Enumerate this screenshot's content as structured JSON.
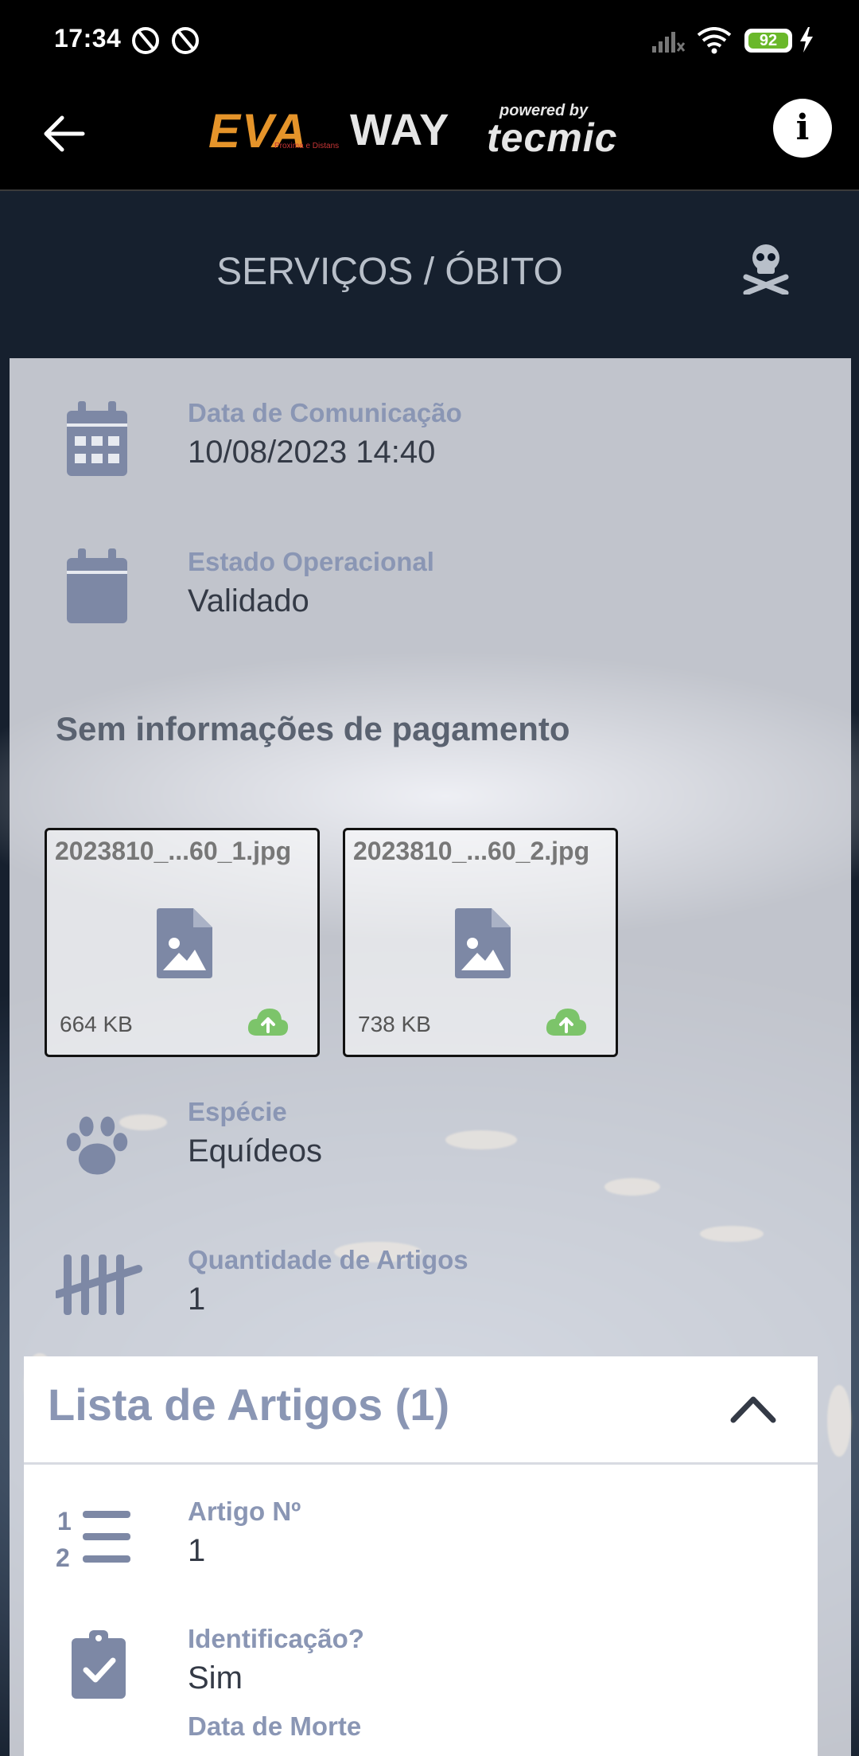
{
  "status_bar": {
    "time": "17:34",
    "battery_level": "92"
  },
  "app_bar": {
    "logo_eva": "EVA",
    "logo_eva_sub": "Proxima e Distans",
    "logo_way": "WAY",
    "powered_by": "powered by",
    "logo_tecmic": "tecmic",
    "info_label": "i"
  },
  "header": {
    "title": "SERVIÇOS / ÓBITO",
    "icon": "skull-crossbones-icon"
  },
  "details": [
    {
      "label": "Data de Comunicação",
      "value": "10/08/2023 14:40",
      "icon": "calendar-grid-icon"
    },
    {
      "label": "Estado Operacional",
      "value": "Validado",
      "icon": "calendar-icon"
    }
  ],
  "payment_message": "Sem informações de pagamento",
  "attachments": [
    {
      "name": "2023810_...60_1.jpg",
      "size": "664 KB",
      "icon": "image-file-icon",
      "status_icon": "cloud-upload-icon"
    },
    {
      "name": "2023810_...60_2.jpg",
      "size": "738 KB",
      "icon": "image-file-icon",
      "status_icon": "cloud-upload-icon"
    }
  ],
  "details_2": [
    {
      "label": "Espécie",
      "value": "Equídeos",
      "icon": "paw-icon"
    },
    {
      "label": "Quantidade de Artigos",
      "value": "1",
      "icon": "tally-icon"
    }
  ],
  "articles_list": {
    "title": "Lista de Artigos (1)",
    "items": [
      {
        "label": "Artigo Nº",
        "value": "1",
        "icon": "numbered-list-icon"
      },
      {
        "label": "Identificação?",
        "value": "Sim",
        "icon": "clipboard-check-icon"
      }
    ],
    "next_label": "Data de Morte"
  },
  "colors": {
    "label": "#8a96b4",
    "value": "#343a46",
    "icon": "#7d88a5",
    "cloud": "#7cc46a",
    "battery": "#6ab82a"
  }
}
